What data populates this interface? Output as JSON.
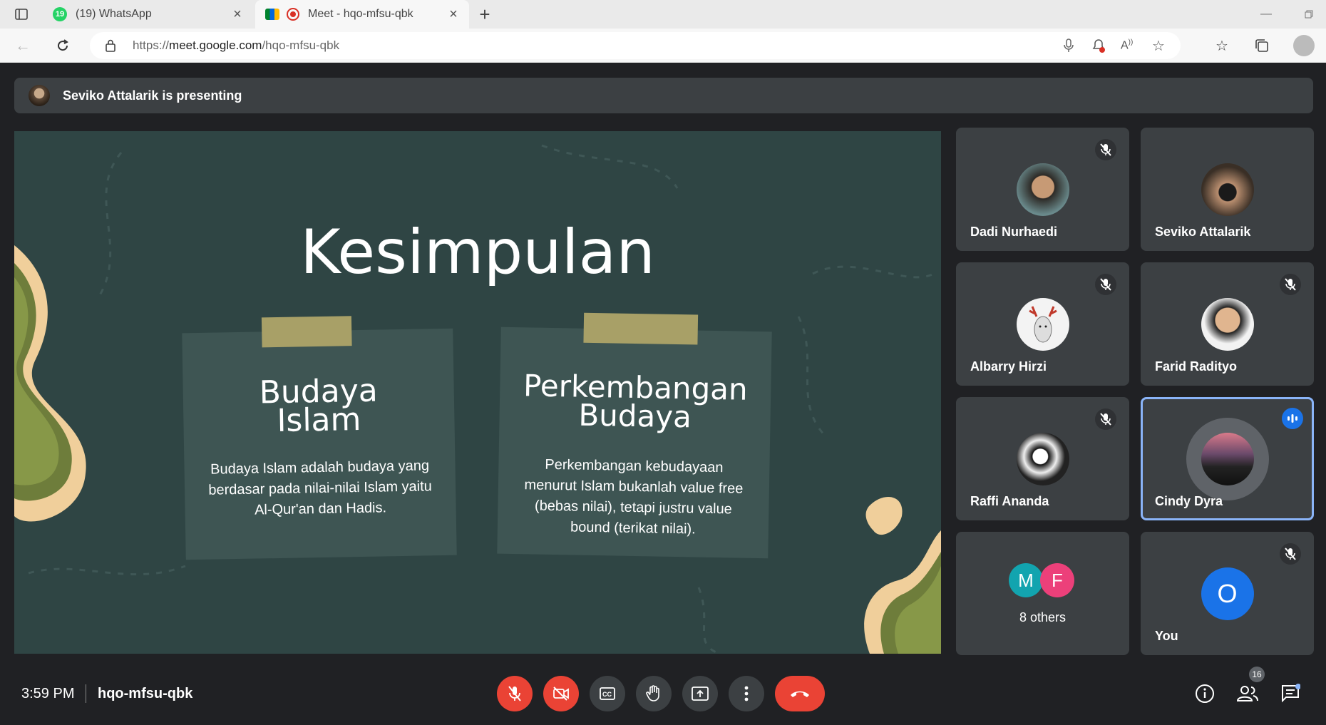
{
  "browser": {
    "tabs": [
      {
        "title": "(19) WhatsApp",
        "badge": "19",
        "color": "#25D366"
      },
      {
        "title": "Meet - hqo-mfsu-qbk",
        "active": true
      }
    ],
    "url": "https://meet.google.com/hqo-mfsu-qbk",
    "url_host": "https://",
    "url_main": "meet.google.com",
    "url_path": "/hqo-mfsu-qbk"
  },
  "meet": {
    "presenting_text": "Seviko Attalarik is presenting",
    "slide": {
      "heading": "Kesimpulan",
      "card1": {
        "title_line1": "Budaya",
        "title_line2": "Islam",
        "body": "Budaya Islam adalah budaya yang berdasar pada nilai-nilai Islam yaitu Al-Qur'an dan Hadis."
      },
      "card2": {
        "title_line1": "Perkembangan",
        "title_line2": "Budaya",
        "body": "Perkembangan kebudayaan menurut Islam bukanlah value free (bebas nilai), tetapi justru value bound (terikat nilai)."
      }
    },
    "participants": [
      {
        "name": "Dadi Nurhaedi",
        "muted": true
      },
      {
        "name": "Seviko Attalarik",
        "muted": false
      },
      {
        "name": "Albarry Hirzi",
        "muted": true
      },
      {
        "name": "Farid Radityo",
        "muted": true
      },
      {
        "name": "Raffi Ananda",
        "muted": true
      },
      {
        "name": "Cindy Dyra",
        "speaking": true
      }
    ],
    "others": {
      "initial1": "M",
      "initial2": "F",
      "label": "8 others"
    },
    "you": {
      "initial": "O",
      "label": "You"
    },
    "time": "3:59 PM",
    "meeting_code": "hqo-mfsu-qbk",
    "people_count": "16",
    "colors": {
      "accent": "#8ab4f8",
      "end_call": "#ea4335",
      "you_avatar": "#1a73e8"
    }
  }
}
